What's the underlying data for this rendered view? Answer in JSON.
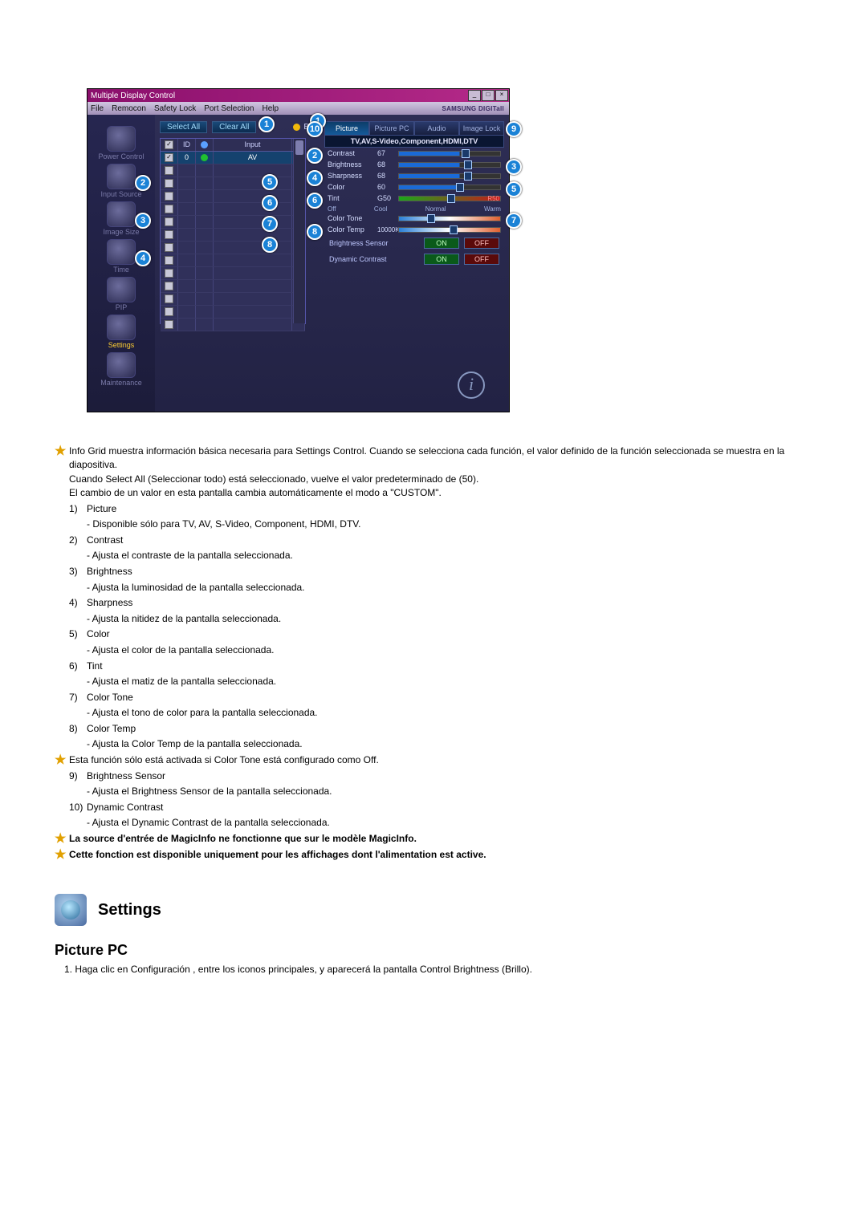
{
  "mdc": {
    "title": "Multiple Display Control",
    "brand": "SAMSUNG DIGITall",
    "menus": [
      "File",
      "Remocon",
      "Safety Lock",
      "Port Selection",
      "Help"
    ],
    "sidebar": [
      {
        "label": "Power Control",
        "name": "sidebar-item-power-control"
      },
      {
        "label": "Input Source",
        "name": "sidebar-item-input-source",
        "badge": "2"
      },
      {
        "label": "Image Size",
        "name": "sidebar-item-image-size",
        "badge": "3"
      },
      {
        "label": "Time",
        "name": "sidebar-item-time",
        "badge": "4"
      },
      {
        "label": "PIP",
        "name": "sidebar-item-pip"
      },
      {
        "label": "Settings",
        "name": "sidebar-item-settings",
        "selected": true
      },
      {
        "label": "Maintenance",
        "name": "sidebar-item-maintenance"
      }
    ],
    "select_all": "Select All",
    "clear_all": "Clear All",
    "busy": "Busy",
    "grid_head": {
      "id": "ID",
      "input": "Input"
    },
    "grid_rows": [
      {
        "checked": true,
        "id": "0",
        "status": "green",
        "input": "AV",
        "selected": true
      },
      {
        "checked": false,
        "id": "",
        "status": "",
        "input": ""
      },
      {
        "checked": false,
        "id": "",
        "status": "",
        "input": ""
      },
      {
        "checked": false,
        "id": "",
        "status": "",
        "input": ""
      },
      {
        "checked": false,
        "id": "",
        "status": "",
        "input": ""
      },
      {
        "checked": false,
        "id": "",
        "status": "",
        "input": ""
      },
      {
        "checked": false,
        "id": "",
        "status": "",
        "input": ""
      },
      {
        "checked": false,
        "id": "",
        "status": "",
        "input": ""
      },
      {
        "checked": false,
        "id": "",
        "status": "",
        "input": ""
      },
      {
        "checked": false,
        "id": "",
        "status": "",
        "input": ""
      },
      {
        "checked": false,
        "id": "",
        "status": "",
        "input": ""
      },
      {
        "checked": false,
        "id": "",
        "status": "",
        "input": ""
      },
      {
        "checked": false,
        "id": "",
        "status": "",
        "input": ""
      },
      {
        "checked": false,
        "id": "",
        "status": "",
        "input": ""
      }
    ],
    "grid_badges": {
      "b1": "1",
      "b5": "5",
      "b6": "6",
      "b7": "7",
      "b8": "8"
    },
    "tabs": [
      "Picture",
      "Picture PC",
      "Audio",
      "Image Lock"
    ],
    "subheader": "TV,AV,S-Video,Component,HDMI,DTV",
    "controls": {
      "contrast": {
        "label": "Contrast",
        "value": "67"
      },
      "brightness": {
        "label": "Brightness",
        "value": "68"
      },
      "sharpness": {
        "label": "Sharpness",
        "value": "68"
      },
      "color": {
        "label": "Color",
        "value": "60"
      },
      "tint": {
        "label": "Tint",
        "left": "G50",
        "right": "R50"
      },
      "colortone": {
        "label": "Color Tone",
        "opts": [
          "Off",
          "Cool",
          "Normal",
          "Warm"
        ]
      },
      "colortemp": {
        "label": "Color Temp",
        "value": "10000K"
      },
      "bsensor": {
        "label": "Brightness Sensor",
        "on": "ON",
        "off": "OFF"
      },
      "dcontrast": {
        "label": "Dynamic Contrast",
        "on": "ON",
        "off": "OFF"
      }
    },
    "right_badges": {
      "b1": "1",
      "b2": "2",
      "b3": "3",
      "b4": "4",
      "b5": "5",
      "b6": "6",
      "b7": "7",
      "b8": "8",
      "b9": "9",
      "b10": "10"
    },
    "info_i": "i"
  },
  "doc": {
    "intro_lines": [
      "Info Grid muestra información básica necesaria para Settings Control. Cuando se selecciona cada función, el valor definido de la función seleccionada se muestra en la diapositiva.",
      "Cuando Select All (Seleccionar todo) está seleccionado, vuelve el valor predeterminado de (50).",
      "El cambio de un valor en esta pantalla cambia automáticamente el modo a \"CUSTOM\"."
    ],
    "items": [
      {
        "n": "1)",
        "t": "Picture",
        "d": "- Disponible sólo para TV, AV, S-Video, Component, HDMI, DTV."
      },
      {
        "n": "2)",
        "t": "Contrast",
        "d": "- Ajusta el contraste de la pantalla seleccionada."
      },
      {
        "n": "3)",
        "t": "Brightness",
        "d": "- Ajusta la luminosidad de la pantalla seleccionada."
      },
      {
        "n": "4)",
        "t": "Sharpness",
        "d": "- Ajusta la nitidez de la pantalla seleccionada."
      },
      {
        "n": "5)",
        "t": "Color",
        "d": "- Ajusta el color de la pantalla seleccionada."
      },
      {
        "n": "6)",
        "t": "Tint",
        "d": "- Ajusta el matiz de la pantalla seleccionada."
      },
      {
        "n": "7)",
        "t": "Color Tone",
        "d": "- Ajusta el tono de color para la pantalla seleccionada."
      },
      {
        "n": "8)",
        "t": "Color Temp",
        "d": "- Ajusta la Color Temp de la pantalla seleccionada."
      }
    ],
    "mid_star": "Esta función sólo está activada si Color Tone está configurado como Off.",
    "items2": [
      {
        "n": "9)",
        "t": "Brightness Sensor",
        "d": "- Ajusta el Brightness Sensor de la pantalla seleccionada."
      },
      {
        "n": "10)",
        "t": "Dynamic Contrast",
        "d": "- Ajusta el Dynamic Contrast de la pantalla seleccionada."
      }
    ],
    "end_stars": [
      "La source d'entrée de MagicInfo ne fonctionne que sur le modèle MagicInfo.",
      "Cette fonction est disponible uniquement pour les affichages dont l'alimentation est active."
    ],
    "settings_heading": "Settings",
    "picture_pc_heading": "Picture PC",
    "picture_pc_step": "1.  Haga clic en Configuración , entre los iconos principales, y aparecerá la pantalla Control Brightness (Brillo)."
  }
}
